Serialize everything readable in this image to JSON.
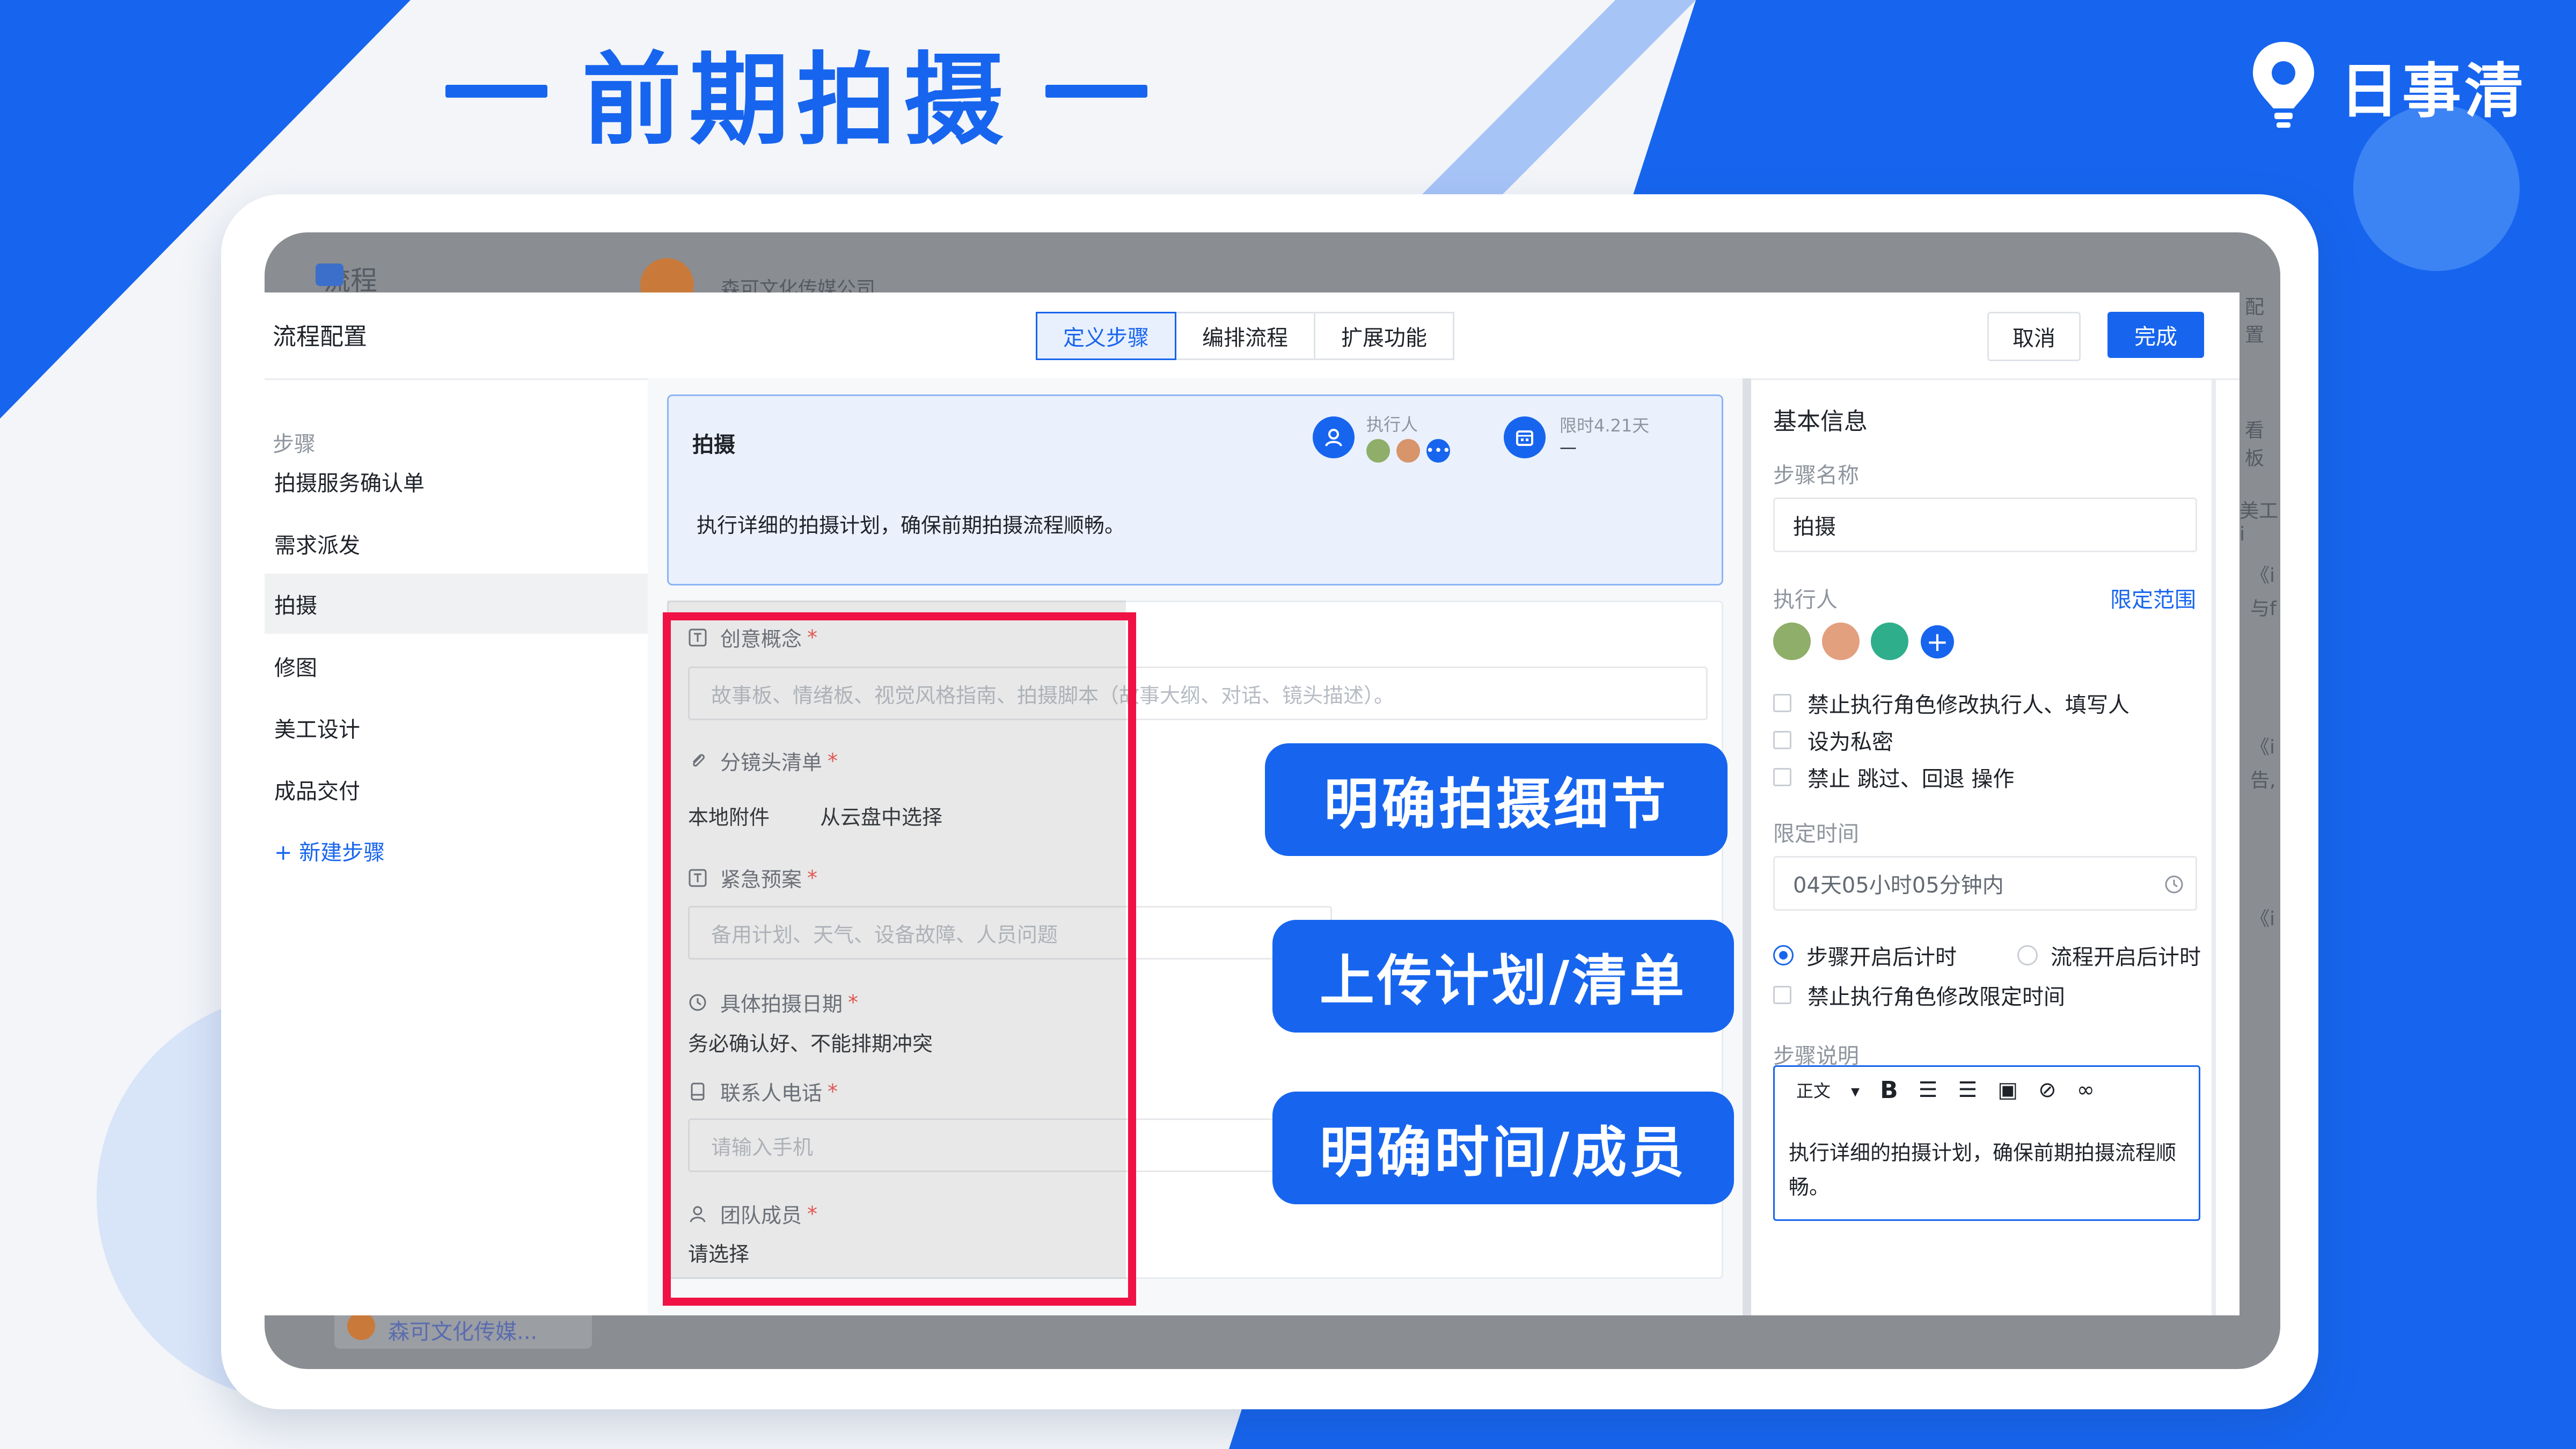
{
  "header": {
    "title": "前期拍摄",
    "brand": "日事清"
  },
  "background_app": {
    "nav_title": "流程",
    "company": "森可文化传媒公司",
    "footer_company": "森可文化传媒...",
    "right_peek": [
      "配置",
      "看板",
      "美工i",
      "《i",
      "与f",
      "《i",
      "告,",
      "《i"
    ]
  },
  "modal": {
    "title": "流程配置",
    "tabs": [
      {
        "label": "定义步骤",
        "active": true
      },
      {
        "label": "编排流程",
        "active": false
      },
      {
        "label": "扩展功能",
        "active": false
      }
    ],
    "cancel_label": "取消",
    "done_label": "完成"
  },
  "steps": {
    "title": "步骤",
    "items": [
      {
        "label": "拍摄服务确认单",
        "active": false
      },
      {
        "label": "需求派发",
        "active": false
      },
      {
        "label": "拍摄",
        "active": true
      },
      {
        "label": "修图",
        "active": false
      },
      {
        "label": "美工设计",
        "active": false
      },
      {
        "label": "成品交付",
        "active": false
      }
    ],
    "new_label": "+ 新建步骤"
  },
  "step_card": {
    "title": "拍摄",
    "executor_label": "执行人",
    "time_label": "限时4.21天",
    "time_value": "—",
    "description": "执行详细的拍摄计划，确保前期拍摄流程顺畅。"
  },
  "fields": [
    {
      "label": "创意概念",
      "required": true,
      "placeholder": "故事板、情绪板、视觉风格指南、拍摄脚本（故事大纲、对话、镜头描述）。"
    },
    {
      "label": "分镜头清单",
      "required": true,
      "options": [
        "本地附件",
        "从云盘中选择"
      ]
    },
    {
      "label": "紧急预案",
      "required": true,
      "placeholder": "备用计划、天气、设备故障、人员问题"
    },
    {
      "label": "具体拍摄日期",
      "required": true,
      "value": "务必确认好、不能排期冲突"
    },
    {
      "label": "联系人电话",
      "required": true,
      "placeholder": "请输入手机"
    },
    {
      "label": "团队成员",
      "required": true,
      "value": "请选择"
    }
  ],
  "callouts": [
    "明确拍摄细节",
    "上传计划/清单",
    "明确时间/成员"
  ],
  "basic_info": {
    "title": "基本信息",
    "name_label": "步骤名称",
    "name_value": "拍摄",
    "executor_label": "执行人",
    "limit_scope_label": "限定范围",
    "checkboxes": [
      "禁止执行角色修改执行人、填写人",
      "设为私密",
      "禁止 跳过、回退 操作"
    ],
    "time_label": "限定时间",
    "time_value": "04天05小时05分钟内",
    "radio_options": [
      {
        "label": "步骤开启后计时",
        "selected": true
      },
      {
        "label": "流程开启后计时",
        "selected": false
      }
    ],
    "time_checkbox": "禁止执行角色修改限定时间",
    "desc_label": "步骤说明",
    "editor_style": "正文",
    "desc_text": "执行详细的拍摄计划，确保前期拍摄流程顺畅。"
  },
  "colors": {
    "accent": "#1765ee",
    "highlight_border": "#f01244"
  }
}
